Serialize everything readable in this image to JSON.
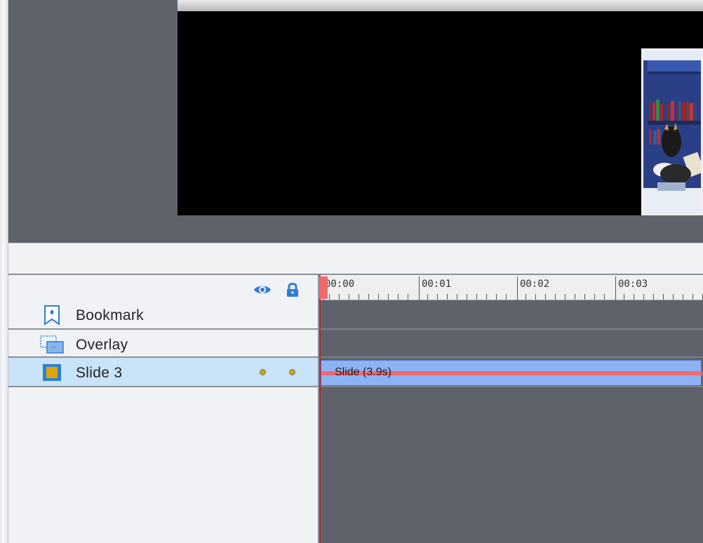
{
  "timeline": {
    "layers": [
      {
        "label": "Bookmark",
        "icon": "bookmark-icon"
      },
      {
        "label": "Overlay",
        "icon": "overlay-icon"
      },
      {
        "label": "Slide 3",
        "icon": "slide-icon"
      }
    ],
    "header_icons": [
      "eye-icon",
      "lock-icon"
    ],
    "ruler_labels": [
      "00:00",
      "00:01",
      "00:02",
      "00:03"
    ],
    "slide_clip_label": "Slide (3.9s)",
    "colors": {
      "selected_row": "#c9e3f8",
      "clip": "#8eb3f5",
      "playhead": "#f0696f",
      "accent_icon": "#2f7fd4",
      "slide_icon_fill": "#e0a400"
    }
  }
}
